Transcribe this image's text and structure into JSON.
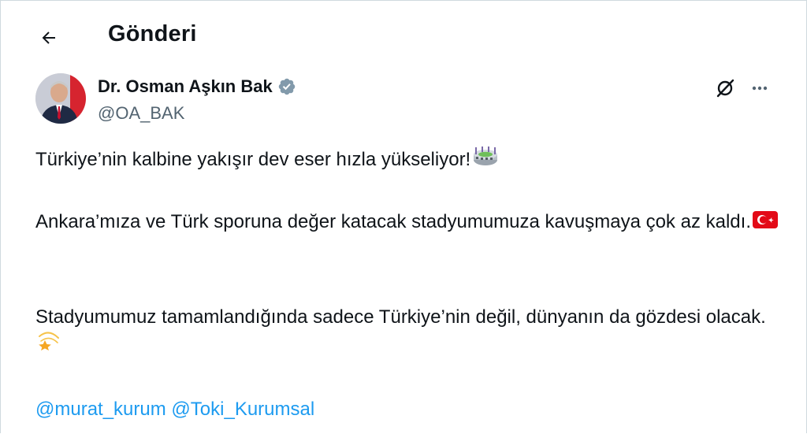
{
  "header": {
    "title": "Gönderi",
    "back_icon": "arrow-left-icon"
  },
  "author": {
    "name": "Dr. Osman Aşkın Bak",
    "handle": "@OA_BAK",
    "verified": true,
    "verified_color": "#829aab"
  },
  "actions": {
    "grok_icon": "grok-icon",
    "more_icon": "more-horizontal-icon"
  },
  "tweet": {
    "paragraph1": "Türkiye’nin kalbine yakışır dev eser hızla yükseliyor!",
    "paragraph1_emoji": "stadium-emoji",
    "paragraph2": "Ankara’mıza ve Türk sporuna değer katacak stadyumumuza kavuşmaya çok az kaldı.",
    "paragraph2_emoji": "turkey-flag-emoji",
    "paragraph3": "Stadyumumuz tamamlandığında sadece Türkiye’nin değil, dünyanın da gözdesi olacak.",
    "paragraph3_emoji": "dizzy-star-emoji",
    "mentions": [
      "@murat_kurum",
      "@Toki_Kurumsal"
    ]
  },
  "colors": {
    "text": "#0f1419",
    "secondary": "#536471",
    "link": "#1d9bf0",
    "flag_red": "#e30a17"
  }
}
